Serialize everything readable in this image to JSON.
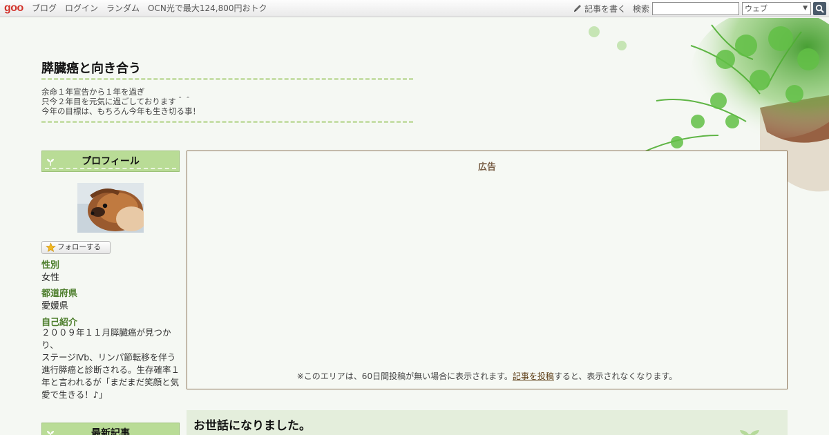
{
  "topbar": {
    "logo": "goo",
    "nav": [
      "ブログ",
      "ログイン",
      "ランダム",
      "OCN光で最大124,800円おトク"
    ],
    "write_label": "記事を書く",
    "search_label": "検索",
    "search_value": "",
    "search_scope": "ウェブ"
  },
  "header": {
    "title": "膵臓癌と向き合う",
    "description": [
      "余命１年宣告から１年を過ぎ",
      "只今２年目を元気に過ごしております＾＾",
      "今年の目標は、もちろん今年も生き切る事！"
    ]
  },
  "sidebar": {
    "profile_heading": "プロフィール",
    "follow_label": "フォローする",
    "fields": [
      {
        "label": "性別",
        "value": "女性"
      },
      {
        "label": "都道府県",
        "value": "愛媛県"
      }
    ],
    "intro_label": "自己紹介",
    "intro_lines": [
      "２００９年１１月膵臓癌が見つかり、",
      "ステージⅣb、リンパ節転移を伴う進行膵癌と診断される。生存確率１年と言われるが「まだまだ笑顔と気愛で生きる！♪」"
    ],
    "recent_heading": "最新記事"
  },
  "ad": {
    "title": "広告",
    "note_before": "※このエリアは、60日間投稿が無い場合に表示されます。",
    "note_link": "記事を投稿",
    "note_after": "すると、表示されなくなります。"
  },
  "entry": {
    "title": "お世話になりました。"
  },
  "colors": {
    "accent_green": "#4d7e2c",
    "heading_green": "#b9dc96",
    "ad_border": "#8a7256",
    "logo_red": "#d2332b"
  }
}
